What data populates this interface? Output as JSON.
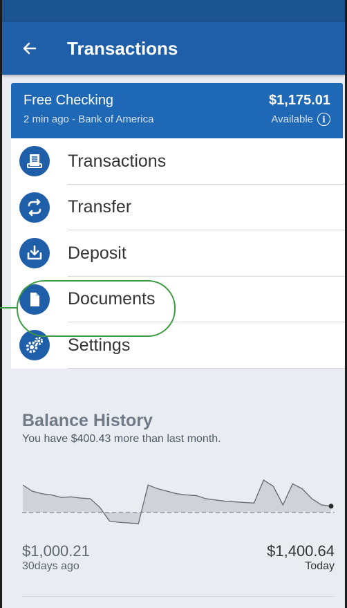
{
  "header": {
    "title": "Transactions",
    "back_icon": "arrow-left-icon"
  },
  "account": {
    "name": "Free Checking",
    "updated": "2 min ago - Bank of America",
    "balance": "$1,175.01",
    "available_label": "Available",
    "info_glyph": "i"
  },
  "menu": {
    "items": [
      {
        "label": "Transactions",
        "icon": "ledger-icon"
      },
      {
        "label": "Transfer",
        "icon": "transfer-arrows-icon"
      },
      {
        "label": "Deposit",
        "icon": "deposit-download-icon"
      },
      {
        "label": "Documents",
        "icon": "document-icon"
      },
      {
        "label": "Settings",
        "icon": "gears-icon"
      }
    ]
  },
  "balance_history": {
    "title": "Balance History",
    "subtitle": "You have $400.43 more than last month.",
    "start_value": "$1,000.21",
    "start_label": "30days ago",
    "end_value": "$1,400.64",
    "end_label": "Today",
    "series": [
      72,
      62,
      58,
      56,
      52,
      53,
      51,
      50,
      36,
      14,
      12,
      11,
      10,
      72,
      66,
      62,
      58,
      56,
      55,
      50,
      48,
      46,
      45,
      44,
      43,
      80,
      70,
      40,
      74,
      66,
      50,
      40,
      38
    ],
    "baseline": 28,
    "colors": {
      "fill": "#cfd3d8",
      "line": "#6a6f75",
      "dashed": "#8a9097",
      "end_dot": "#2a2a2a"
    }
  },
  "theme": {
    "primary": "#1f5ea8",
    "status_bar": "#1c5391",
    "card": "#1f68b5",
    "highlight": "#3a9a3f"
  }
}
